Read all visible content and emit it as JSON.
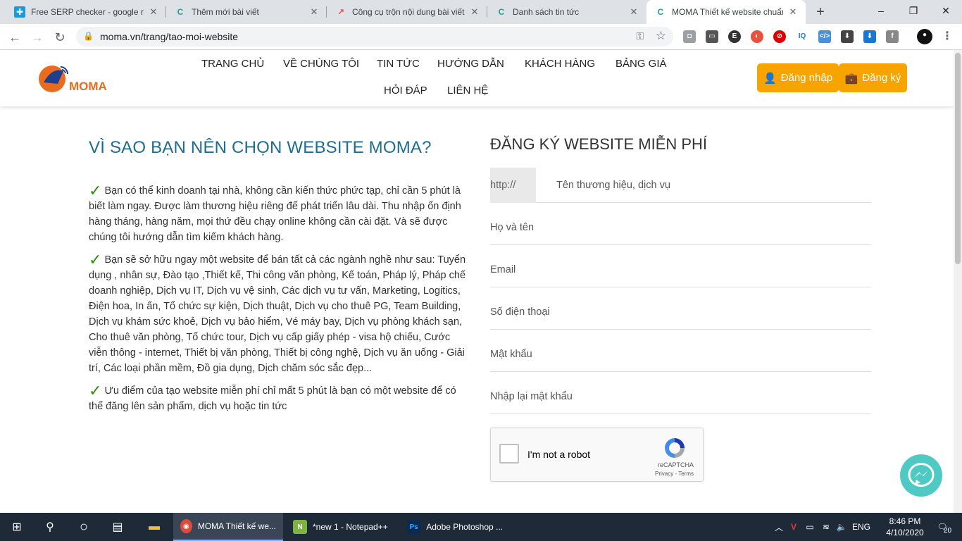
{
  "browser": {
    "tabs": [
      {
        "title": "Free SERP checker - google ran",
        "icon_color": "#1a9bd7",
        "icon_glyph": "✚"
      },
      {
        "title": "Thêm mới bài viết",
        "icon_color": "#2a9d8f",
        "icon_glyph": "C"
      },
      {
        "title": "Công cụ trộn nội dung bài viết",
        "icon_color": "#e74c3c",
        "icon_glyph": "↗"
      },
      {
        "title": "Danh sách tin tức",
        "icon_color": "#2a9d8f",
        "icon_glyph": "C"
      },
      {
        "title": "MOMA Thiết kế website chuẩn",
        "icon_color": "#2a9d8f",
        "icon_glyph": "C"
      }
    ],
    "new_tab_label": "+",
    "url": "moma.vn/trang/tao-moi-website",
    "back_icon": "←",
    "forward_icon": "→",
    "reload_icon": "↻",
    "minimize_icon": "–",
    "maximize_icon": "❐",
    "close_icon": "✕"
  },
  "site": {
    "logo_text": "MOMA",
    "menu": [
      "TRANG CHỦ",
      "VỀ CHÚNG TÔI",
      "TIN TỨC",
      "HƯỚNG DẪN",
      "KHÁCH HÀNG",
      "BẢNG GIÁ",
      "HỎI ĐÁP",
      "LIÊN HỆ"
    ],
    "login_label": "Đăng nhập",
    "register_label": "Đăng ký",
    "accent": "#f7a400"
  },
  "left": {
    "heading": "VÌ SAO BẠN NÊN CHỌN WEBSITE MOMA?",
    "paragraphs": [
      "Bạn có thể kinh doanh tại nhà, không cần kiến thức phức tạp, chỉ cần 5 phút là biết làm ngay. Được làm thương hiệu riêng để phát triển lâu dài. Thu nhập ổn định hàng tháng, hàng năm, mọi thứ đều chạy online không cần cài đặt. Và sẽ được chúng tôi hướng dẫn tìm kiếm khách hàng.",
      "Bạn sẽ sở hữu ngay một website để bán tất cả các ngành nghề như sau: Tuyển dụng , nhân sự, Đào tạo ,Thiết kế, Thi công văn phòng, Kế toán, Pháp lý, Pháp chế doanh nghiệp, Dịch vụ IT, Dịch vụ vệ sinh, Các dịch vụ tư vấn, Marketing, Logitics, Điện hoa, In ấn, Tổ chức sự kiện, Dịch thuật, Dịch vụ cho thuê PG, Team Building, Dịch vụ khám sức khoẻ, Dịch vụ bảo hiểm, Vé máy bay, Dịch vụ phòng khách sạn, Cho thuê văn phòng, Tổ chức tour, Dịch vụ cấp giấy phép - visa hộ chiếu, Cước viễn thông - internet, Thiết bị văn phòng, Thiết bị công nghệ, Dịch vụ ăn uống - Giải trí, Các loại phần mềm, Đồ gia dụng, Dịch chăm sóc sắc đẹp...",
      "Ưu điểm của tạo website miễn phí chỉ mất 5 phút là bạn có một website để có thể đăng lên sản phẩm, dịch vụ hoặc tin tức"
    ]
  },
  "form": {
    "heading": "ĐĂNG KÝ WEBSITE MIỄN PHÍ",
    "url_prefix": "http://",
    "brand_placeholder": "Tên thương hiệu, dịch vụ",
    "fullname_placeholder": "Họ và tên",
    "email_placeholder": "Email",
    "phone_placeholder": "Số điện thoại",
    "password_placeholder": "Mật khẩu",
    "confirm_placeholder": "Nhập lại mật khẩu",
    "captcha_label": "I'm not a robot",
    "captcha_brand": "reCAPTCHA",
    "captcha_terms": "Privacy - Terms"
  },
  "taskbar": {
    "apps": [
      {
        "label": "MOMA Thiết kế we...",
        "icon_color": "#dd4b39",
        "glyph": "◉"
      },
      {
        "label": "*new 1 - Notepad++",
        "icon_color": "#7cb342",
        "glyph": "N"
      },
      {
        "label": "Adobe Photoshop ...",
        "icon_color": "#0a2a52",
        "glyph": "Ps"
      }
    ],
    "language": "ENG",
    "time": "8:46 PM",
    "date": "4/10/2020",
    "notification_count": "20"
  }
}
